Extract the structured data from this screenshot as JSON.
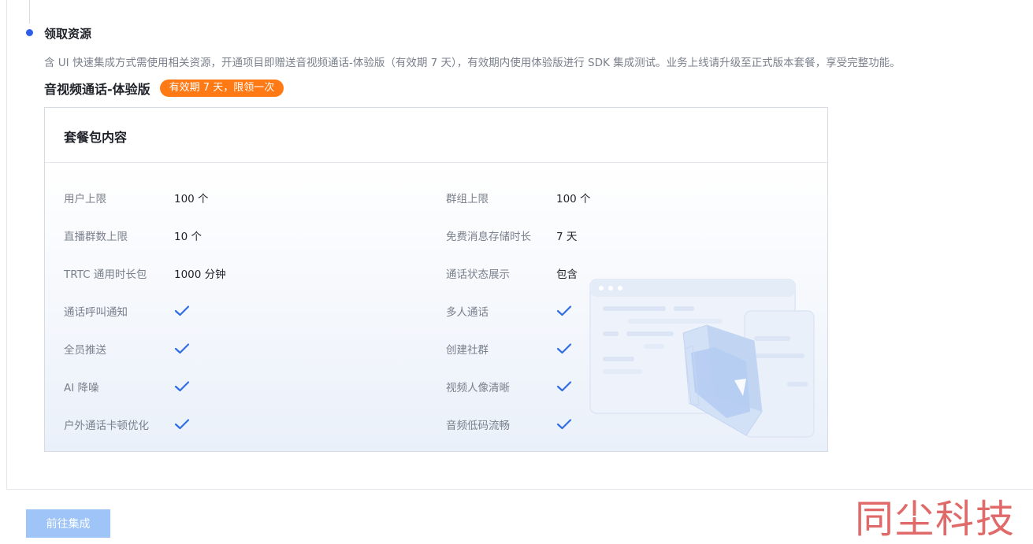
{
  "section": {
    "title": "领取资源",
    "description": "含 UI 快速集成方式需使用相关资源，开通项目即赠送音视频通话-体验版（有效期 7 天），有效期内使用体验版进行 SDK 集成测试。业务上线请升级至正式版本套餐，享受完整功能。"
  },
  "package": {
    "title": "音视频通话-体验版",
    "badge": "有效期 7 天，限领一次",
    "badge_color": "#ff7a14"
  },
  "card": {
    "title": "套餐包内容",
    "features": [
      {
        "label": "用户上限",
        "value": "100 个"
      },
      {
        "label": "群组上限",
        "value": "100 个"
      },
      {
        "label": "直播群数上限",
        "value": "10 个"
      },
      {
        "label": "免费消息存储时长",
        "value": "7 天"
      },
      {
        "label": "TRTC 通用时长包",
        "value": "1000 分钟"
      },
      {
        "label": "通话状态展示",
        "value": "包含"
      },
      {
        "label": "通话呼叫通知",
        "icon": "check-icon"
      },
      {
        "label": "多人通话",
        "icon": "check-icon"
      },
      {
        "label": "全员推送",
        "icon": "check-icon"
      },
      {
        "label": "创建社群",
        "icon": "check-icon"
      },
      {
        "label": "AI 降噪",
        "icon": "check-icon"
      },
      {
        "label": "视频人像清晰",
        "icon": "check-icon"
      },
      {
        "label": "户外通话卡顿优化",
        "icon": "check-icon"
      },
      {
        "label": "音频低码流畅",
        "icon": "check-icon"
      }
    ]
  },
  "footer": {
    "go_button": "前往集成",
    "button_color": "#9ec4f8"
  },
  "watermark": "同尘科技",
  "colors": {
    "accent": "#2f5fe8",
    "check": "#2f6ee6"
  }
}
